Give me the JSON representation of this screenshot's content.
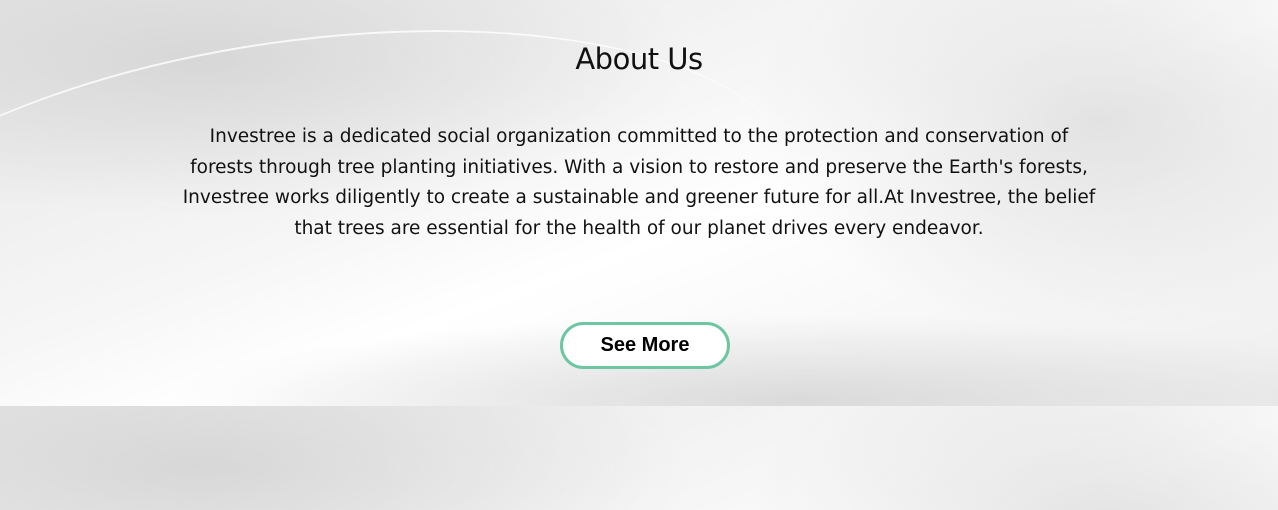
{
  "about": {
    "title": "About Us",
    "body": "Investree is a dedicated social organization committed to the protection and conservation of forests through tree planting initiatives. With a vision to restore and preserve the Earth's forests, Investree works diligently to create a sustainable and greener future for all.At Investree, the belief that trees are essential for the health of our planet drives every endeavor.",
    "button_label": "See More",
    "accent_color": "#6cc6a2"
  }
}
